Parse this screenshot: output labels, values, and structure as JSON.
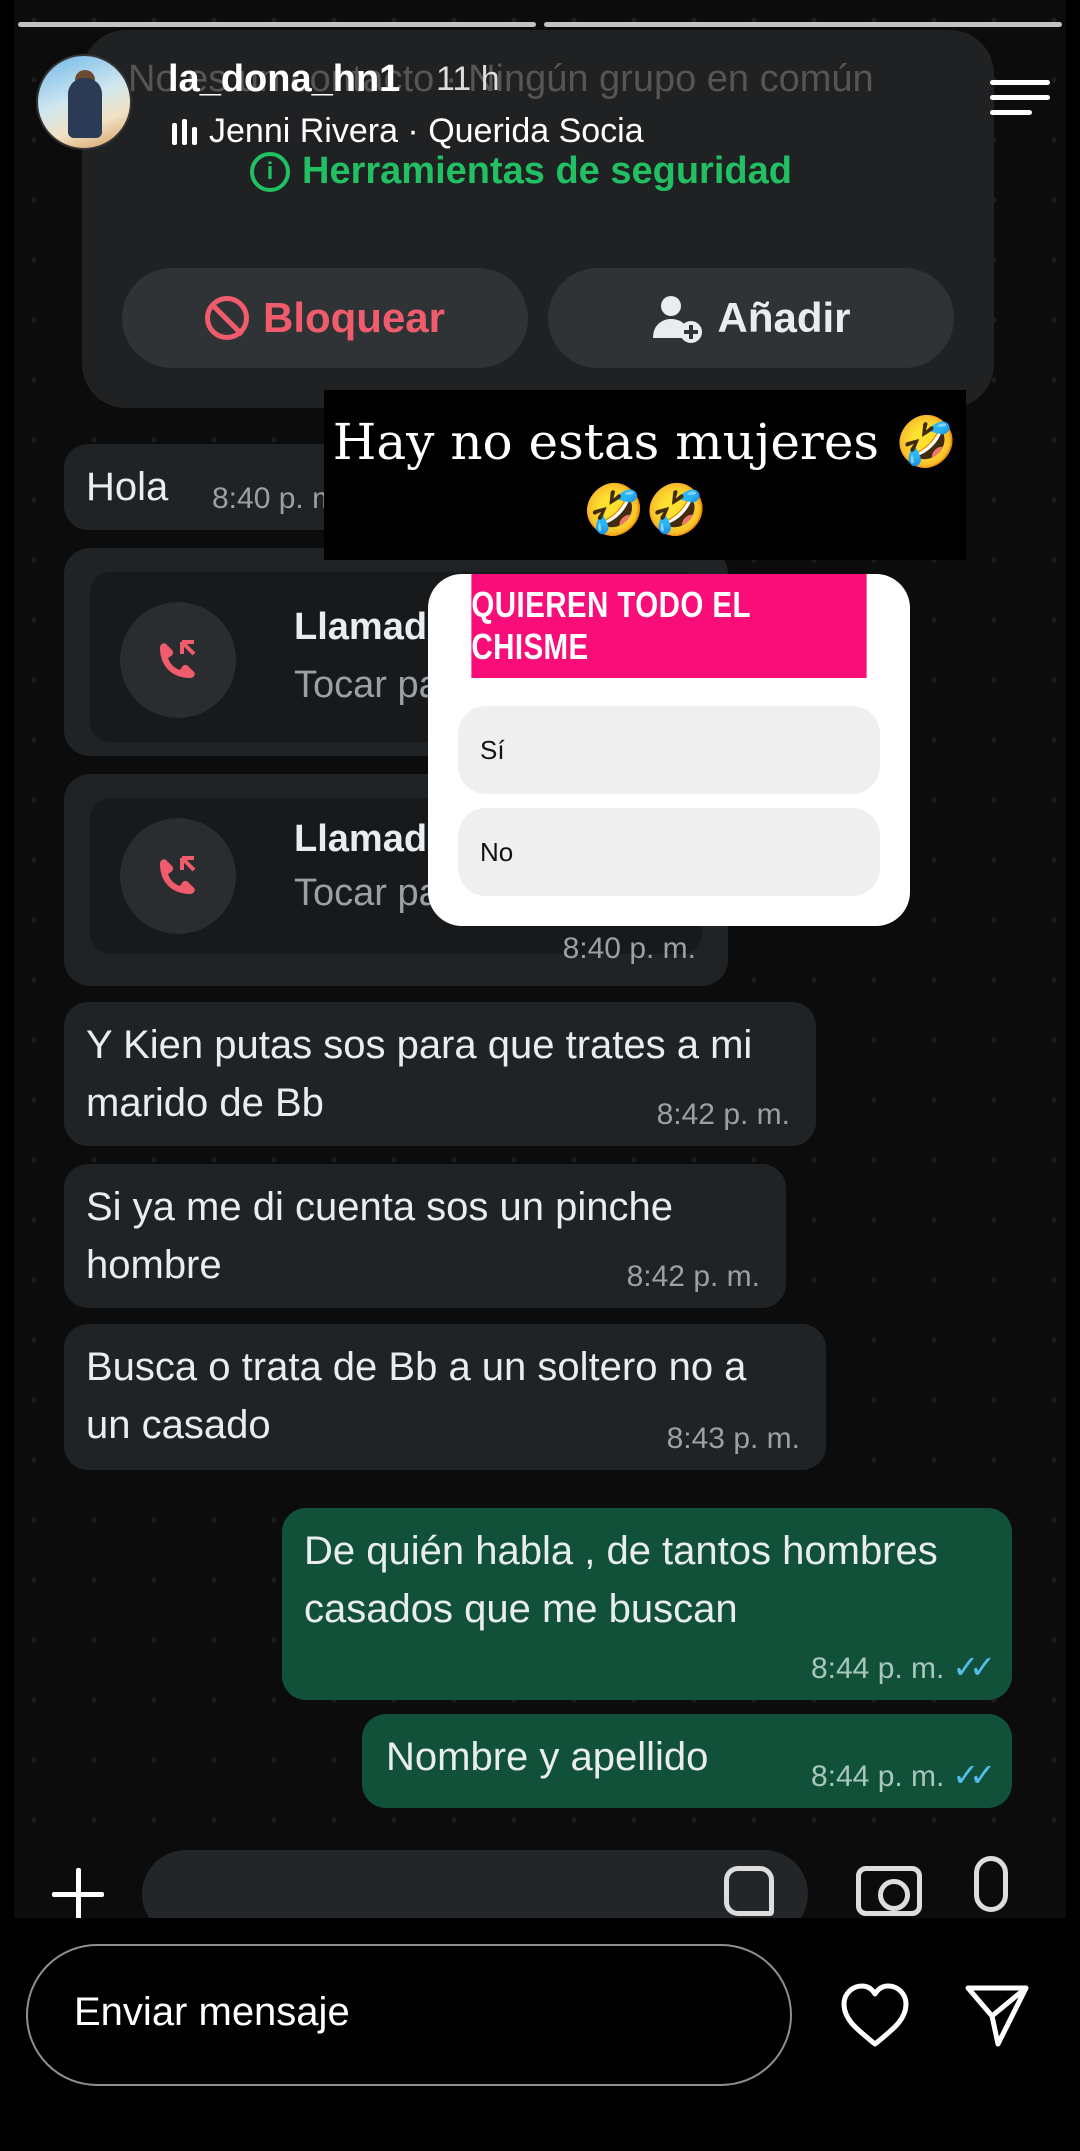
{
  "story": {
    "username": "la_dona_hn1",
    "time_ago": "11 h",
    "music": "Jenni Rivera · Querida Socia",
    "progress_segments": 2
  },
  "whatsapp": {
    "faded_contact": "No es un contacto · Ningún grupo en común",
    "safety_tools": "Herramientas de seguridad",
    "block_label": "Bloquear",
    "add_label": "Añadir",
    "messages": [
      {
        "dir": "in",
        "text": "Hola",
        "time": "8:40 p. m."
      },
      {
        "dir": "call",
        "title": "Llamada p",
        "sub": "Tocar para",
        "time": ""
      },
      {
        "dir": "call",
        "title": "Llamada p",
        "sub": "Tocar para",
        "time": "8:40 p. m."
      },
      {
        "dir": "in",
        "text": "Y Kien putas sos para que trates a mi marido de Bb",
        "time": "8:42 p. m."
      },
      {
        "dir": "in",
        "text": "Si ya me di cuenta sos un pinche hombre",
        "time": "8:42 p. m."
      },
      {
        "dir": "in",
        "text": "Busca o trata de Bb a un soltero no a un casado",
        "time": "8:43 p. m."
      },
      {
        "dir": "out",
        "text": "De quién habla , de tantos hombres casados que me buscan",
        "time": "8:44 p. m."
      },
      {
        "dir": "out",
        "text": "Nombre y apellido",
        "time": "8:44 p. m."
      }
    ]
  },
  "caption": {
    "line1": "Hay no estas mujeres 🤣",
    "line2": "🤣🤣"
  },
  "poll": {
    "question": "QUIEREN TODO EL CHISME",
    "options": [
      "Sí",
      "No"
    ],
    "accent": "#f80d79"
  },
  "reply": {
    "placeholder": "Enviar mensaje"
  },
  "colors": {
    "incoming_bubble": "#1f2326",
    "outgoing_bubble": "#11513a",
    "safety_green": "#21c063",
    "block_red": "#f15c6d"
  }
}
